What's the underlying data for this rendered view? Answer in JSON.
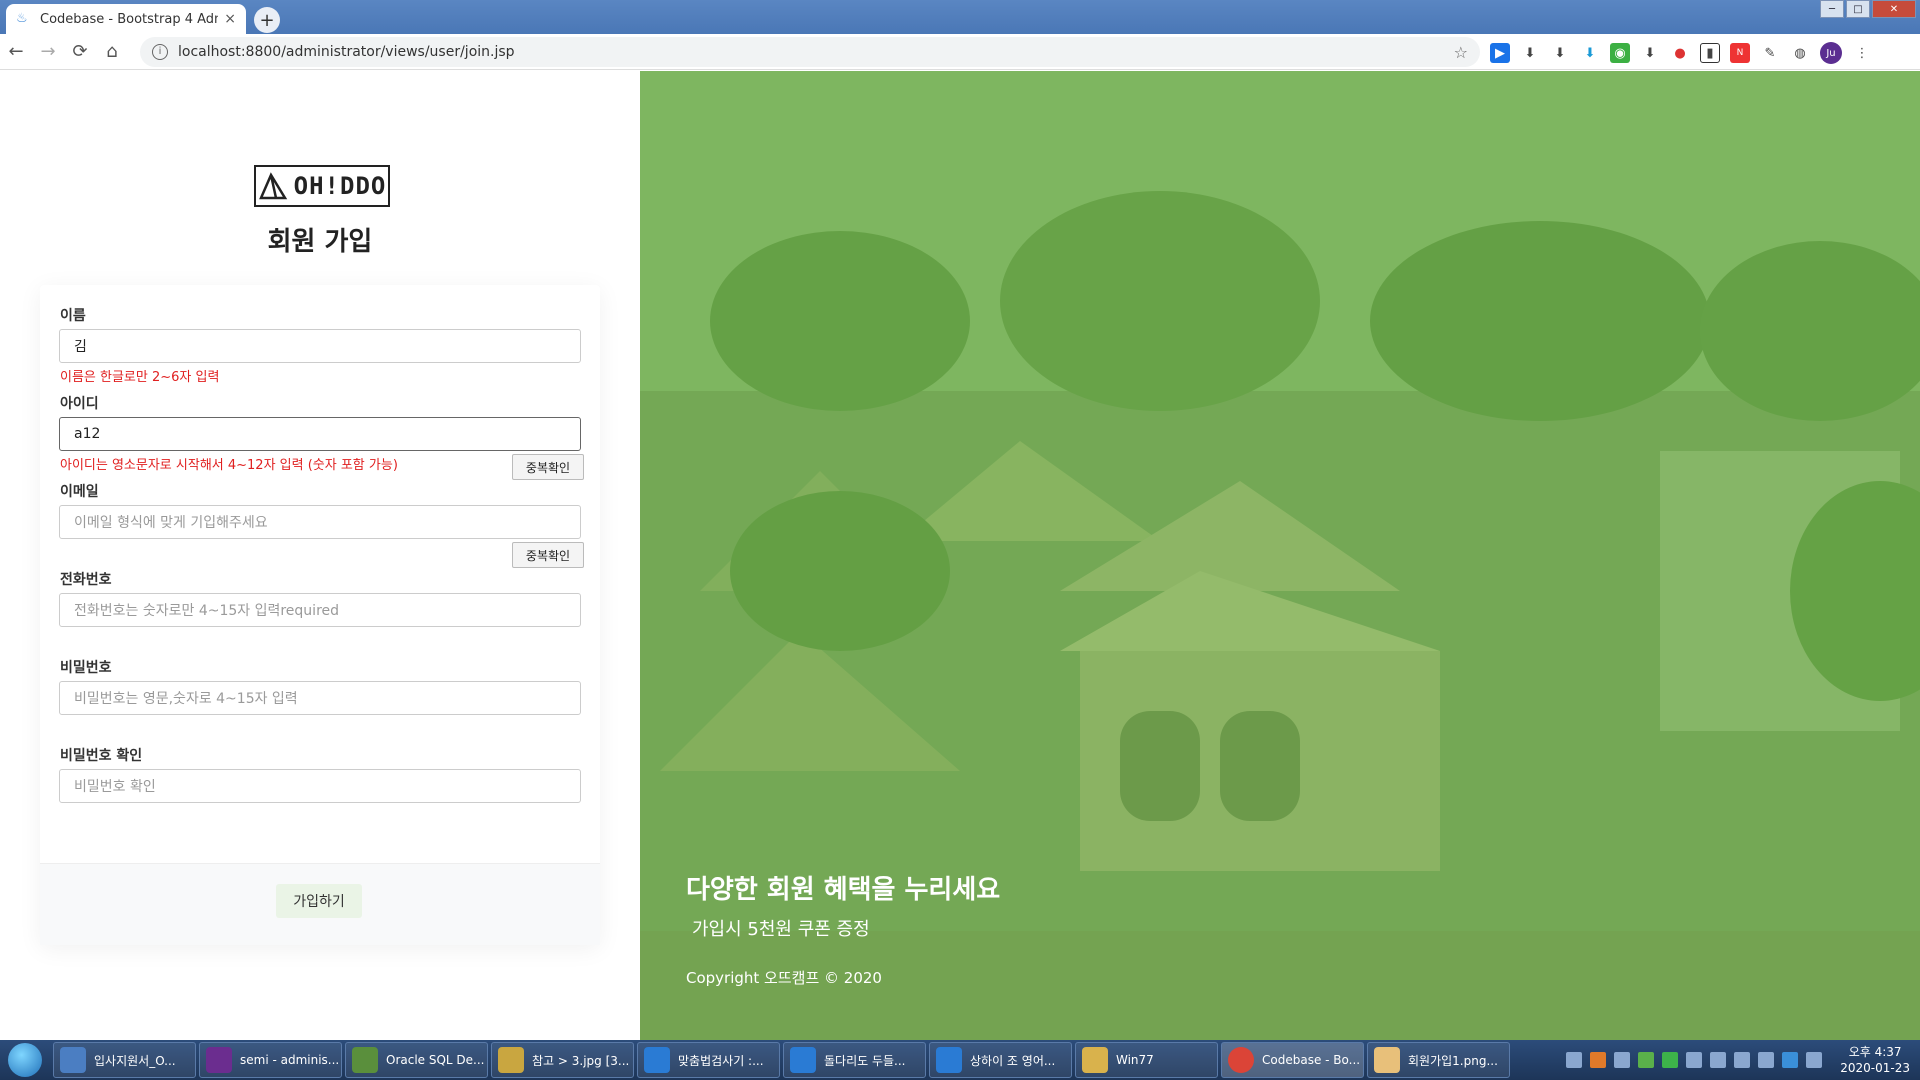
{
  "browser": {
    "tab_title": "Codebase - Bootstrap 4 Admin",
    "tab_close": "×",
    "new_tab": "+",
    "url": "localhost:8800/administrator/views/user/join.jsp",
    "back": "←",
    "forward": "→",
    "reload": "⟳",
    "home": "⌂",
    "star": "☆",
    "avatar": "Ju",
    "win_min": "─",
    "win_max": "□",
    "win_close": "✕"
  },
  "form": {
    "logo_text": "OH!DDO",
    "heading": "회원 가입",
    "fields": {
      "name": {
        "label": "이름",
        "value": "김",
        "msg": "이름은 한글로만 2~6자 입력"
      },
      "id": {
        "label": "아이디",
        "value": "a12",
        "msg": "아이디는 영소문자로 시작해서 4~12자 입력 (숫자 포함 가능)",
        "dup_button": "중복확인"
      },
      "email": {
        "label": "이메일",
        "placeholder": "이메일 형식에 맞게 기입해주세요",
        "dup_button": "중복확인"
      },
      "phone": {
        "label": "전화번호",
        "placeholder": "전화번호는 숫자로만 4~15자 입력required"
      },
      "password": {
        "label": "비밀번호",
        "placeholder": "비밀번호는 영문,숫자로 4~15자 입력"
      },
      "password_confirm": {
        "label": "비밀번호 확인",
        "placeholder": "비밀번호 확인"
      }
    },
    "submit": "가입하기"
  },
  "hero": {
    "title": "다양한 회원 혜택을 누리세요",
    "subtitle": "가입시 5천원 쿠폰 증정",
    "copyright": "Copyright 오뜨캠프 © 2020"
  },
  "taskbar": {
    "items": [
      "입사지원서_O...",
      "semi - adminis...",
      "Oracle SQL De...",
      "참고 > 3.jpg [3...",
      "맞춤법검사기 :...",
      "돌다리도 두들...",
      "상하이 조 영어...",
      "Win77",
      "Codebase - Bo...",
      "회원가입1.png..."
    ],
    "clock_time": "오후 4:37",
    "clock_date": "2020-01-23"
  }
}
